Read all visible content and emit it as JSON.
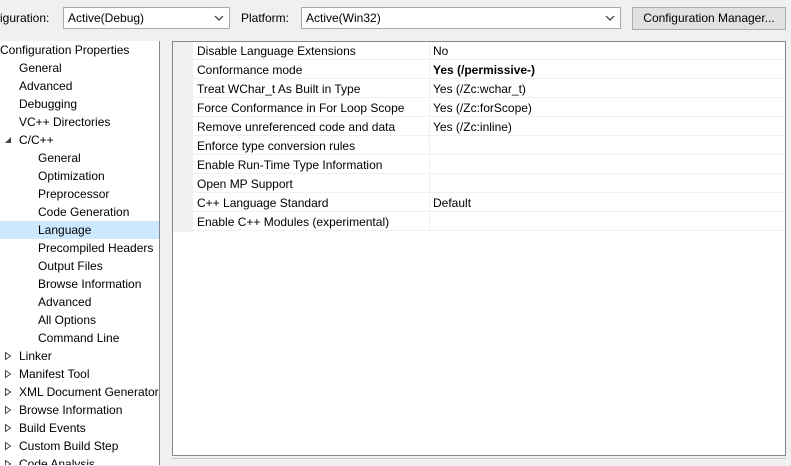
{
  "toolbar": {
    "configuration_label": "iguration:",
    "configuration_value": "Active(Debug)",
    "platform_label": "Platform:",
    "platform_value": "Active(Win32)",
    "config_manager_button": "Configuration Manager..."
  },
  "tree": {
    "root": "Configuration Properties",
    "items": [
      {
        "label": "General"
      },
      {
        "label": "Advanced"
      },
      {
        "label": "Debugging"
      },
      {
        "label": "VC++ Directories"
      },
      {
        "label": "C/C++"
      },
      {
        "label": "General"
      },
      {
        "label": "Optimization"
      },
      {
        "label": "Preprocessor"
      },
      {
        "label": "Code Generation"
      },
      {
        "label": "Language"
      },
      {
        "label": "Precompiled Headers"
      },
      {
        "label": "Output Files"
      },
      {
        "label": "Browse Information"
      },
      {
        "label": "Advanced"
      },
      {
        "label": "All Options"
      },
      {
        "label": "Command Line"
      },
      {
        "label": "Linker"
      },
      {
        "label": "Manifest Tool"
      },
      {
        "label": "XML Document Generator"
      },
      {
        "label": "Browse Information"
      },
      {
        "label": "Build Events"
      },
      {
        "label": "Custom Build Step"
      },
      {
        "label": "Code Analysis"
      }
    ]
  },
  "properties": [
    {
      "name": "Disable Language Extensions",
      "value": "No"
    },
    {
      "name": "Conformance mode",
      "value": "Yes (/permissive-)"
    },
    {
      "name": "Treat WChar_t As Built in Type",
      "value": "Yes (/Zc:wchar_t)"
    },
    {
      "name": "Force Conformance in For Loop Scope",
      "value": "Yes (/Zc:forScope)"
    },
    {
      "name": "Remove unreferenced code and data",
      "value": "Yes (/Zc:inline)"
    },
    {
      "name": "Enforce type conversion rules",
      "value": ""
    },
    {
      "name": "Enable Run-Time Type Information",
      "value": ""
    },
    {
      "name": "Open MP Support",
      "value": ""
    },
    {
      "name": "C++ Language Standard",
      "value": "Default"
    },
    {
      "name": "Enable C++ Modules (experimental)",
      "value": ""
    }
  ],
  "colors": {
    "selection": "#cce8ff",
    "panel_bg": "#f0f0f0",
    "border": "#828790"
  },
  "icons": {
    "dropdown": "chevron-down-icon",
    "expanded": "expanded-triangle-icon",
    "collapsed": "collapsed-triangle-icon"
  }
}
